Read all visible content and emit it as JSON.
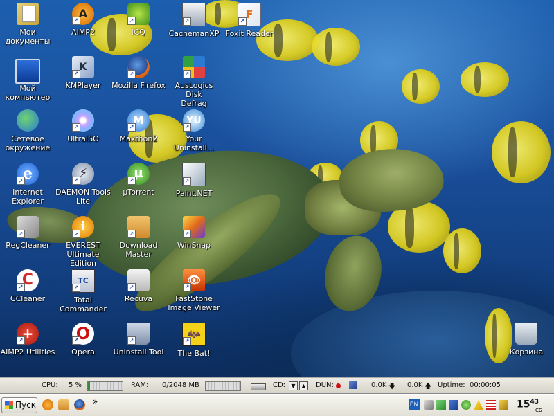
{
  "desktop": {
    "icons": [
      {
        "label": "Мои\nдокументы",
        "icon": "my-documents-icon"
      },
      {
        "label": "Мой\nкомпьютер",
        "icon": "my-computer-icon"
      },
      {
        "label": "Сетевое\nокружение",
        "icon": "network-places-icon"
      },
      {
        "label": "Internet\nExplorer",
        "icon": "internet-explorer-icon"
      },
      {
        "label": "RegCleaner",
        "icon": "regcleaner-icon"
      },
      {
        "label": "CCleaner",
        "icon": "ccleaner-icon"
      },
      {
        "label": "AIMP2 Utilities",
        "icon": "aimp2-utilities-icon"
      },
      {
        "label": "AIMP2",
        "icon": "aimp2-icon"
      },
      {
        "label": "KMPlayer",
        "icon": "kmplayer-icon"
      },
      {
        "label": "UltraISO",
        "icon": "ultraiso-icon"
      },
      {
        "label": "DAEMON Tools\nLite",
        "icon": "daemon-tools-icon"
      },
      {
        "label": "EVEREST\nUltimate Edition",
        "icon": "everest-icon"
      },
      {
        "label": "Total\nCommander",
        "icon": "total-commander-icon"
      },
      {
        "label": "Opera",
        "icon": "opera-icon"
      },
      {
        "label": "ICQ",
        "icon": "icq-icon"
      },
      {
        "label": "Mozilla Firefox",
        "icon": "firefox-icon"
      },
      {
        "label": "Maxthon2",
        "icon": "maxthon-icon"
      },
      {
        "label": "µTorrent",
        "icon": "utorrent-icon"
      },
      {
        "label": "Download\nMaster",
        "icon": "download-master-icon"
      },
      {
        "label": "Recuva",
        "icon": "recuva-icon"
      },
      {
        "label": "Uninstall Tool",
        "icon": "uninstall-tool-icon"
      },
      {
        "label": "CachemanXP",
        "icon": "cachemanxp-icon"
      },
      {
        "label": "AusLogics Disk\nDefrag",
        "icon": "auslogics-defrag-icon"
      },
      {
        "label": "Your\nUninstall...",
        "icon": "your-uninstaller-icon"
      },
      {
        "label": "Paint.NET",
        "icon": "paint-net-icon"
      },
      {
        "label": "WinSnap",
        "icon": "winsnap-icon"
      },
      {
        "label": "FastStone\nImage Viewer",
        "icon": "faststone-icon"
      },
      {
        "label": "The Bat!",
        "icon": "the-bat-icon"
      },
      {
        "label": "Foxit Reader",
        "icon": "foxit-reader-icon"
      },
      {
        "label": "Корзина",
        "icon": "recycle-bin-icon"
      }
    ],
    "glyphs": {
      "ie": "e",
      "ccleaner": "C",
      "aimp2u": "+",
      "aimp": "A",
      "km": "K",
      "daemon": "⚡",
      "everest": "i",
      "tc": "TC",
      "opera": "O",
      "max": "M",
      "ut": "µ",
      "yu": "YU",
      "fs": "👁",
      "bat": "🦇",
      "foxit": "F"
    },
    "shortcut_arrow": "↗"
  },
  "monitor": {
    "cpu_label": "CPU:",
    "cpu_value": "5 %",
    "cpu_level": 0.05,
    "ram_label": "RAM:",
    "ram_value": "0/2048 MB",
    "ram_level": 0.0,
    "cd_label": "CD:",
    "cd_down": "▼",
    "cd_eject": "▲",
    "dun_label": "DUN:",
    "download_speed": "0.0K",
    "download_arrow": "🡇",
    "upload_speed": "0.0K",
    "upload_arrow": "🡅",
    "uptime_label": "Uptime:",
    "uptime_value": "00:00:05"
  },
  "taskbar": {
    "start_label": "Пуск",
    "overflow_chevron": "»",
    "language": "EN",
    "clock_hours": "15",
    "clock_minutes": "43",
    "clock_day": "СБ"
  },
  "colors": {
    "ocean": "#1a4f9c",
    "taskbar": "#eceae2",
    "fish": "#e3d21a"
  }
}
